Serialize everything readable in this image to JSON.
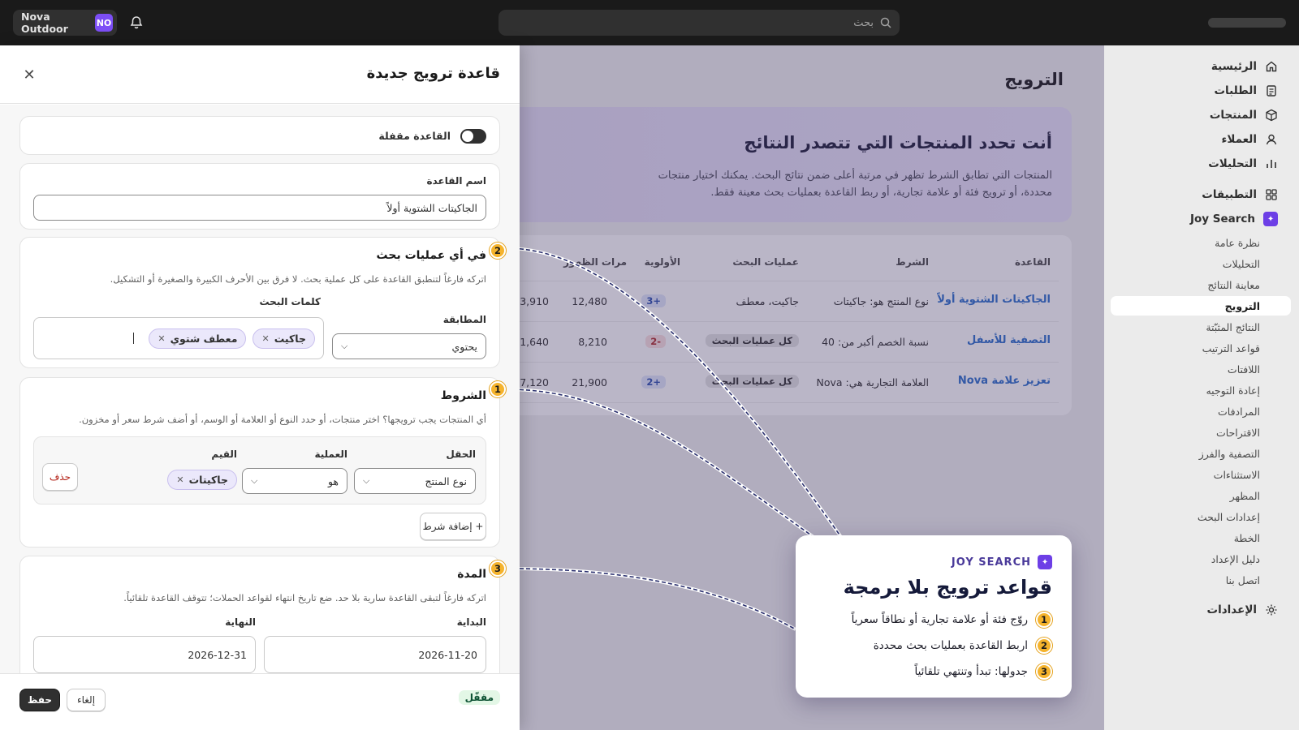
{
  "topbar": {
    "store_name": "Nova Outdoor",
    "store_initials": "NO",
    "search_placeholder": "بحث"
  },
  "sidebar": {
    "items": [
      "الرئيسية",
      "الطلبات",
      "المنتجات",
      "العملاء",
      "التحليلات",
      "التطبيقات"
    ],
    "app_name": "Joy Search",
    "subitems": [
      "نظرة عامة",
      "التحليلات",
      "معاينة النتائج",
      "الترويج",
      "النتائج المثبّتة",
      "قواعد الترتيب",
      "اللافتات",
      "إعادة التوجيه",
      "المرادفات",
      "الاقتراحات",
      "التصفية والفرز",
      "الاستثناءات",
      "المظهر",
      "إعدادات البحث",
      "الخطة",
      "دليل الإعداد",
      "اتصل بنا"
    ],
    "active_subitem": "الترويج",
    "settings": "الإعدادات"
  },
  "page": {
    "title": "الترويج",
    "hero_title": "أنت تحدد المنتجات التي تتصدر النتائج",
    "hero_text": "المنتجات التي تطابق الشرط تظهر في مرتبة أعلى ضمن نتائج البحث. يمكنك اختيار منتجات محددة، أو ترويج فئة أو علامة تجارية، أو ربط القاعدة بعمليات بحث معينة فقط.",
    "table": {
      "headers": [
        "القاعدة",
        "الشرط",
        "عمليات البحث",
        "الأولوية",
        "مرات الظهور"
      ],
      "rows": [
        {
          "rule": "الجاكيتات الشتوية أولاً",
          "condition": "نوع المنتج هو: جاكيتات",
          "searches": "جاكيت، معطف",
          "priority": "+3",
          "impressions": "12,480",
          "extra": "3,910"
        },
        {
          "rule": "التصفية للأسفل",
          "condition": "نسبة الخصم أكبر من: 40",
          "searches": "كل عمليات البحث",
          "priority": "-2",
          "impressions": "8,210",
          "extra": "1,640"
        },
        {
          "rule": "تعزيز علامة Nova",
          "condition": "العلامة التجارية هي: Nova",
          "searches": "كل عمليات البحث",
          "priority": "+2",
          "impressions": "21,900",
          "extra": "7,120"
        }
      ]
    }
  },
  "callout": {
    "brand": "JOY SEARCH",
    "title": "قواعد ترويج بلا برمجة",
    "steps": [
      {
        "n": "1",
        "text": "روّج فئة أو علامة تجارية أو نطاقاً سعرياً"
      },
      {
        "n": "2",
        "text": "اربط القاعدة بعمليات بحث محددة"
      },
      {
        "n": "3",
        "text": "جدولها: تبدأ وتنتهي تلقائياً"
      }
    ]
  },
  "panel": {
    "title": "قاعدة ترويج جديدة",
    "toggle_label": "القاعدة مقفلة",
    "name_label": "اسم القاعدة",
    "name_value": "الجاكيتات الشتوية أولاً",
    "searches": {
      "badge": "2",
      "title": "في أي عمليات بحث",
      "help": "اتركه فارغاً لتنطبق القاعدة على كل عملية بحث. لا فرق بين الأحرف الكبيرة والصغيرة أو التشكيل.",
      "match_label": "المطابقة",
      "match_value": "يحتوي",
      "keywords_label": "كلمات البحث",
      "chips": [
        "جاكيت",
        "معطف شتوي"
      ]
    },
    "conditions": {
      "badge": "1",
      "title": "الشروط",
      "help": "أي المنتجات يجب ترويجها؟ اختر منتجات، أو حدد النوع أو العلامة أو الوسم، أو أضف شرط سعر أو مخزون.",
      "field_label": "الحقل",
      "field_value": "نوع المنتج",
      "op_label": "العملية",
      "op_value": "هو",
      "values_label": "القيم",
      "value_chip": "جاكيتات",
      "delete_label": "حذف",
      "add_label": "+ إضافة شرط"
    },
    "duration": {
      "badge": "3",
      "title": "المدة",
      "help": "اتركه فارغاً لتبقى القاعدة سارية بلا حد. ضع تاريخ انتهاء لقواعد الحملات؛ تتوقف القاعدة تلقائياً.",
      "start_label": "البداية",
      "start_value": "2026-11-20",
      "end_label": "النهاية",
      "end_value": "2026-12-31"
    },
    "footer": {
      "status": "مقفّل",
      "cancel": "إلغاء",
      "save": "حفظ"
    }
  },
  "colors": {
    "accent": "#6d3fe6",
    "badge": "#f5b32c",
    "link": "#2c6ecb",
    "overlay": "#403464"
  }
}
